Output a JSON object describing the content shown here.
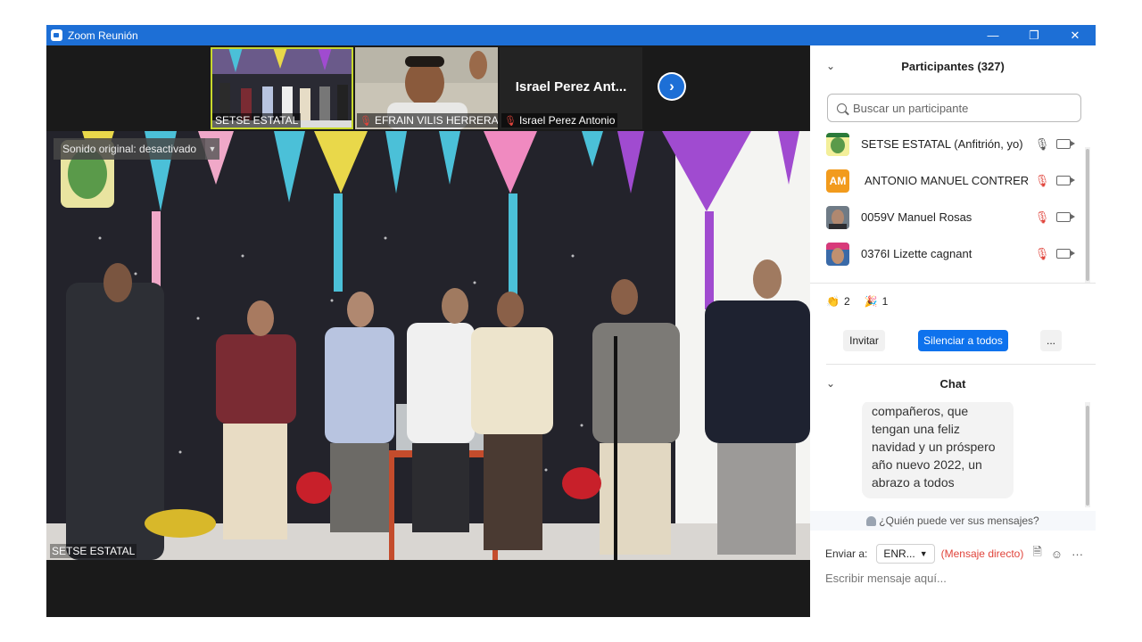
{
  "window": {
    "title": "Zoom Reunión"
  },
  "thumbnails": [
    {
      "name": "SETSE ESTATAL",
      "muted": false,
      "active": true
    },
    {
      "name": "EFRAIN VILIS HERRERA",
      "muted": true,
      "active": false
    },
    {
      "name": "Israel Perez Antonio",
      "display_name": "Israel Perez Ant...",
      "muted": true,
      "active": false
    }
  ],
  "main_video": {
    "sound_label": "Sonido original: desactivado",
    "speaker_name": "SETSE ESTATAL"
  },
  "participants": {
    "header": "Participantes (327)",
    "search_placeholder": "Buscar un participante",
    "list": [
      {
        "name": "SETSE ESTATAL (Anfitrión, yo)",
        "avatar": "logo",
        "mic": "on"
      },
      {
        "name": "ANTONIO MANUEL CONTRER...",
        "avatar": "AM",
        "mic": "off"
      },
      {
        "name": "0059V Manuel Rosas",
        "avatar": "photo",
        "mic": "off"
      },
      {
        "name": "0376I Lizette cagnant",
        "avatar": "photo",
        "mic": "off"
      }
    ],
    "reactions": [
      {
        "icon": "clap-icon",
        "glyph": "👏",
        "count": "2"
      },
      {
        "icon": "party-icon",
        "glyph": "🎉",
        "count": "1"
      }
    ],
    "invite_label": "Invitar",
    "mute_all_label": "Silenciar a todos",
    "more_label": "..."
  },
  "chat": {
    "header": "Chat",
    "message_lines": [
      "compañeros, que",
      "tengan una feliz",
      "navidad y un próspero",
      "año nuevo 2022, un",
      "abrazo a todos"
    ],
    "who_can_see": "¿Quién puede ver sus mensajes?",
    "send_to_label": "Enviar a:",
    "send_to_value": "ENR...",
    "direct_label": "(Mensaje directo)",
    "compose_placeholder": "Escribir mensaje aquí..."
  },
  "colors": {
    "zoom_blue": "#1d6fd6",
    "button_blue": "#0e72ed",
    "muted_red": "#e0443b",
    "active_outline": "#c8d82c"
  }
}
